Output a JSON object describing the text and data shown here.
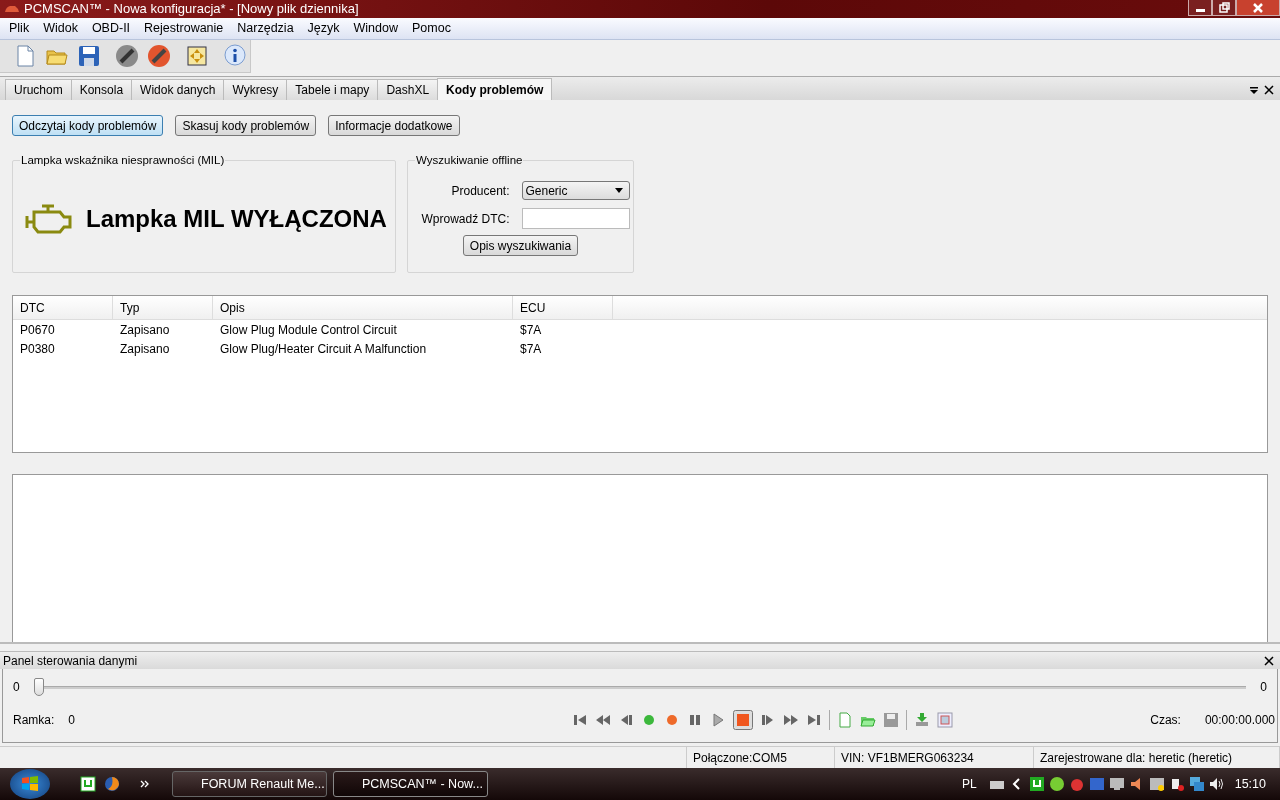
{
  "window": {
    "title": "PCMSCAN™ - Nowa konfiguracja* - [Nowy plik dziennika]"
  },
  "menu": [
    "Plik",
    "Widok",
    "OBD-II",
    "Rejestrowanie",
    "Narzędzia",
    "Język",
    "Window",
    "Pomoc"
  ],
  "tabs": [
    {
      "label": "Uruchom",
      "selected": false
    },
    {
      "label": "Konsola",
      "selected": false
    },
    {
      "label": "Widok danych",
      "selected": false
    },
    {
      "label": "Wykresy",
      "selected": false
    },
    {
      "label": "Tabele i mapy",
      "selected": false
    },
    {
      "label": "DashXL",
      "selected": false
    },
    {
      "label": "Kody problemów",
      "selected": true
    }
  ],
  "actions": [
    {
      "label": "Odczytaj kody problemów",
      "focused": true
    },
    {
      "label": "Skasuj kody problemów",
      "focused": false
    },
    {
      "label": "Informacje dodatkowe",
      "focused": false
    }
  ],
  "mil": {
    "title": "Lampka wskaźnika niesprawności (MIL)",
    "on": false,
    "status": "Lampka MIL WYŁĄCZONA"
  },
  "offline_search": {
    "title": "Wyszukiwanie offline",
    "producer_label": "Producent:",
    "producer_value": "Generic",
    "dtc_label": "Wprowadź DTC:",
    "button": "Opis wyszukiwania"
  },
  "table": {
    "columns": [
      "DTC",
      "Typ",
      "Opis",
      "ECU"
    ],
    "rows": [
      [
        "P0670",
        "Zapisano",
        "Glow Plug Module Control Circuit",
        "$7A"
      ],
      [
        "P0380",
        "Zapisano",
        "Glow Plug/Heater Circuit A Malfunction",
        "$7A"
      ]
    ]
  },
  "data_panel": {
    "title": "Panel sterowania danymi",
    "slider_min": "0",
    "slider_max": "0",
    "level": 0,
    "frame_label": "Ramka:",
    "frame_value": "0",
    "time_label": "Czas:",
    "time_value": "00:00:00.000"
  },
  "status_bar": [
    "Połączone:COM5",
    "VIN: VF1BMERG063234",
    "Zarejestrowane dla: heretic (heretic)"
  ],
  "taskbar": {
    "tasks": [
      {
        "label": "FORUM Renault Me...",
        "selected": false
      },
      {
        "label": "PCMSCAN™ - Now...",
        "selected": true
      }
    ],
    "language": "PL",
    "clock": "15:10"
  }
}
